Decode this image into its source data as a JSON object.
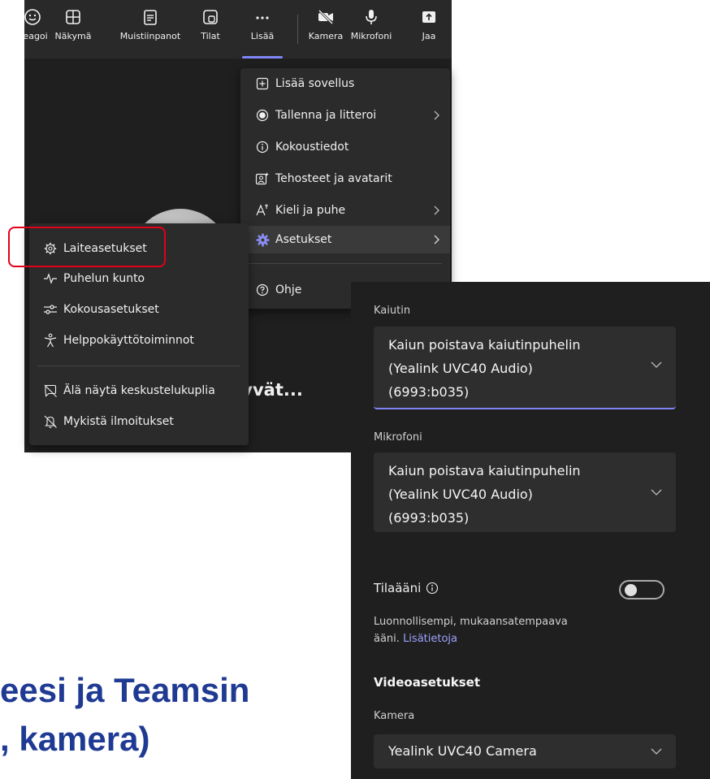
{
  "toolbar": {
    "react": "Reagoi",
    "view": "Näkymä",
    "notes": "Muistiinpanot",
    "rooms": "Tilat",
    "more": "Lisää",
    "camera": "Kamera",
    "mic": "Mikrofoni",
    "share": "Jaa"
  },
  "more_menu": {
    "add_app": "Lisää sovellus",
    "record": "Tallenna ja litteroi",
    "meeting_info": "Kokoustiedot",
    "effects": "Tehosteet ja avatarit",
    "language": "Kieli ja puhe",
    "settings": "Asetukset",
    "help": "Ohje"
  },
  "settings_menu": {
    "device_settings": "Laiteasetukset",
    "call_health": "Puhelun kunto",
    "meeting_settings": "Kokousasetukset",
    "accessibility": "Helppokäyttötoiminnot",
    "no_bubbles": "Älä näytä keskustelukuplia",
    "mute_notifications": "Mykistä ilmoitukset"
  },
  "meeting": {
    "partial_title": "ittyvät..."
  },
  "panel": {
    "speaker_label": "Kaiutin",
    "speaker_lines": [
      "Kaiun poistava kaiutinpuhelin",
      "(Yealink UVC40 Audio)",
      "(6993:b035)"
    ],
    "mic_label": "Mikrofoni",
    "mic_lines": [
      "Kaiun poistava kaiutinpuhelin",
      "(Yealink UVC40 Audio)",
      "(6993:b035)"
    ],
    "spatial_label": "Tilaääni",
    "spatial_desc1": "Luonnollisempi, mukaansatempaava",
    "spatial_desc2": "ääni.",
    "learn_more": "Lisätietoja",
    "video_heading": "Videoasetukset",
    "camera_label": "Kamera",
    "camera_value": "Yealink UVC40 Camera",
    "spatial_on": false
  },
  "background": {
    "line1": "eesi ja Teamsin",
    "line2": ", kamera)"
  },
  "colors": {
    "accent": "#7f85f5",
    "highlight": "#e2001a",
    "heading": "#1f3a93"
  }
}
